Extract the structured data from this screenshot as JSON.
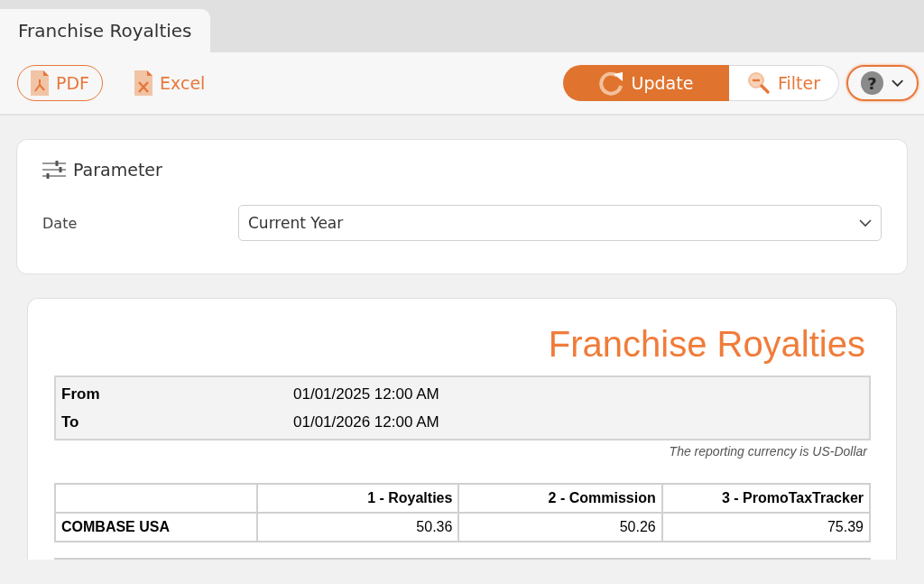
{
  "tabs": [
    {
      "label": "Franchise Royalties",
      "selected": true
    }
  ],
  "toolbar": {
    "export_buttons": [
      {
        "label": "PDF",
        "kind": "pdf",
        "outlined": true
      },
      {
        "label": "Excel",
        "kind": "excel",
        "outlined": false
      }
    ],
    "update_button": {
      "label": "Update"
    },
    "filter_button": {
      "label": "Filter"
    },
    "help_button": {
      "label": "?"
    }
  },
  "parameters": {
    "title": "Parameter",
    "fields": [
      {
        "label": "Date",
        "value": "Current Year"
      }
    ]
  },
  "report": {
    "title": "Franchise Royalties",
    "period": [
      {
        "label": "From",
        "value": "01/01/2025 12:00 AM"
      },
      {
        "label": "To",
        "value": "01/01/2026 12:00 AM"
      }
    ],
    "currency_note": "The reporting currency is US-Dollar",
    "table": {
      "columns": [
        "",
        "1 - Royalties",
        "2 - Commission",
        "3 - PromoTaxTracker"
      ],
      "rows": [
        [
          "COMBASE USA",
          "50.36",
          "50.26",
          "75.39"
        ]
      ]
    }
  }
}
